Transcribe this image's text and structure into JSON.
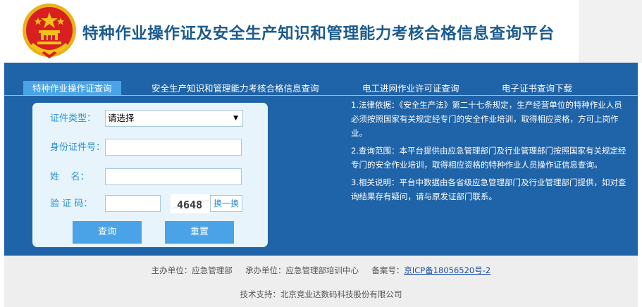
{
  "header": {
    "title": "特种作业操作证及安全生产知识和管理能力考核合格信息查询平台"
  },
  "tabs": [
    {
      "label": "特种作业操作证查询",
      "active": true
    },
    {
      "label": "安全生产知识和管理能力考核合格信息查询",
      "active": false
    },
    {
      "label": "电工进网作业许可证查询",
      "active": false
    },
    {
      "label": "电子证书查询下载",
      "active": false
    }
  ],
  "form": {
    "cert_type_label": "证件类型：",
    "cert_type_value": "请选择",
    "id_label": "身份证件号：",
    "id_value": "",
    "name_label": "姓    名：",
    "name_value": "",
    "captcha_label": "验 证 码：",
    "captcha_value": "",
    "captcha_image_text": "4648",
    "swap_label": "换一换",
    "query_button": "查询",
    "reset_button": "重置"
  },
  "notes": [
    "1.法律依据：《安全生产法》第二十七条规定，生产经营单位的特种作业人员必须按照国家有关规定经专门的安全作业培训，取得相应资格，方可上岗作业。",
    "2.查询范围：本平台提供由应急管理部门及行业管理部门按照国家有关规定经专门的安全作业培训，取得相应资格的特种作业人员操作证信息查询。",
    "3.相关说明：平台中数据由各省级应急管理部门及行业管理部门提供，如对查询结果存有疑问，请与原发证部门联系。"
  ],
  "footer": {
    "host": "主办单位：应急管理部",
    "organizer": "承办单位：应急管理部培训中心",
    "icp_label": "备案号：",
    "icp_link": "京ICP备18056520号-2",
    "tech_support": "技术支持：北京竞业达数码科技股份有限公司"
  },
  "colors": {
    "band": "#1f63a8",
    "tab_active": "#4aa3e6",
    "title": "#1b5b8f",
    "emblem_red": "#d7201f",
    "emblem_gold": "#f4c21a"
  }
}
